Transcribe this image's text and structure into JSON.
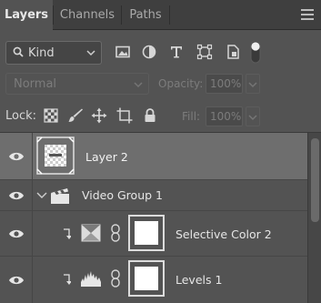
{
  "tabs": [
    {
      "label": "Layers",
      "active": true
    },
    {
      "label": "Channels",
      "active": false
    },
    {
      "label": "Paths",
      "active": false
    }
  ],
  "filter": {
    "kind_label": "Kind",
    "icons": [
      "image-filter-icon",
      "adjustment-filter-icon",
      "type-filter-icon",
      "shape-filter-icon",
      "smart-object-filter-icon",
      "filter-toggle-icon"
    ]
  },
  "blend": {
    "mode": "Normal",
    "opacity_label": "Opacity:",
    "opacity_value": "100%",
    "fill_label": "Fill:",
    "fill_value": "100%"
  },
  "lock": {
    "label": "Lock:",
    "icons": [
      "lock-transparent-pixels-icon",
      "lock-image-pixels-icon",
      "lock-position-icon",
      "lock-artboard-icon",
      "lock-all-icon"
    ]
  },
  "layers": [
    {
      "name": "Layer 2",
      "selected": true,
      "type": "pixel"
    },
    {
      "name": "Video Group 1",
      "selected": false,
      "type": "video-group"
    },
    {
      "name": "Selective Color 2",
      "selected": false,
      "type": "selective-color-adjustment"
    },
    {
      "name": "Levels 1",
      "selected": false,
      "type": "levels-adjustment"
    }
  ],
  "colors": {
    "panel_bg": "#535353",
    "tabbar_bg": "#3f3f3f",
    "selected_row": "#6e6e6e",
    "text": "#e6e6e6"
  }
}
